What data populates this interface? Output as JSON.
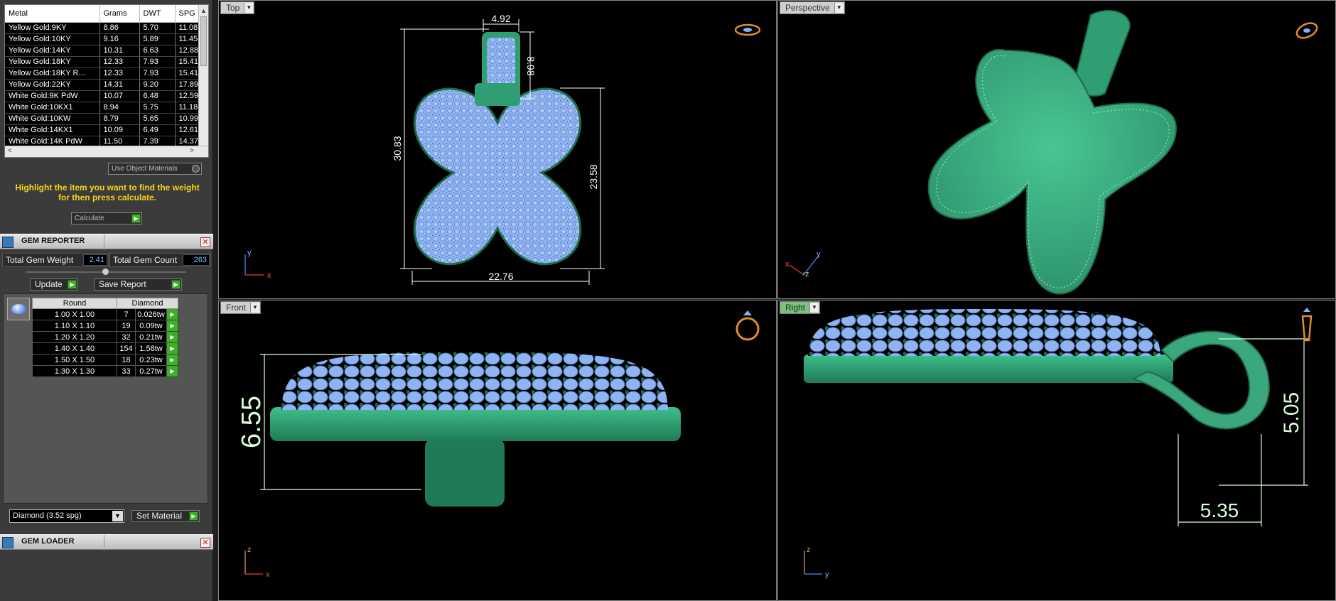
{
  "metal_table": {
    "headers": [
      "Metal",
      "Grams",
      "DWT",
      "SPG"
    ],
    "rows": [
      [
        "Yellow Gold:9KY",
        "8.86",
        "5.70",
        "11.08"
      ],
      [
        "Yellow Gold:10KY",
        "9.16",
        "5.89",
        "11.45"
      ],
      [
        "Yellow Gold:14KY",
        "10.31",
        "6.63",
        "12.88"
      ],
      [
        "Yellow Gold:18KY",
        "12.33",
        "7.93",
        "15.41"
      ],
      [
        "Yellow Gold:18KY R...",
        "12.33",
        "7.93",
        "15.41"
      ],
      [
        "Yellow Gold:22KY",
        "14.31",
        "9.20",
        "17.89"
      ],
      [
        "White Gold:9K PdW",
        "10.07",
        "6.48",
        "12.59"
      ],
      [
        "White Gold:10KX1",
        "8.94",
        "5.75",
        "11.18"
      ],
      [
        "White Gold:10KW",
        "8.79",
        "5.65",
        "10.99"
      ],
      [
        "White Gold:14KX1",
        "10.09",
        "6.49",
        "12.61"
      ],
      [
        "White Gold:14K PdW",
        "11.50",
        "7.39",
        "14.37"
      ]
    ]
  },
  "use_object_materials_label": "Use Object Materials",
  "hint_line1": "Highlight the item you want to find the weight",
  "hint_line2": "for then press calculate.",
  "calculate_label": "Calculate",
  "gem_reporter": {
    "title": "GEM REPORTER",
    "total_weight_label": "Total Gem Weight",
    "total_weight_value": "2.41",
    "total_count_label": "Total Gem Count",
    "total_count_value": "263",
    "update_label": "Update",
    "save_report_label": "Save Report",
    "table_headers": [
      "Round",
      "Diamond"
    ],
    "rows": [
      [
        "1.00 X 1.00",
        "7",
        "0.026tw"
      ],
      [
        "1.10 X 1.10",
        "19",
        "0.09tw"
      ],
      [
        "1.20 X 1.20",
        "32",
        "0.21tw"
      ],
      [
        "1.40 X 1.40",
        "154",
        "1.58tw"
      ],
      [
        "1.50 X 1.50",
        "18",
        "0.23tw"
      ],
      [
        "1.30 X 1.30",
        "33",
        "0.27tw"
      ]
    ]
  },
  "material_select_value": "Diamond    (3.52 spg)",
  "set_material_label": "Set Material",
  "gem_loader": {
    "title": "GEM LOADER"
  },
  "viewports": {
    "top": {
      "label": "Top",
      "dims": {
        "bail_width": "4.92",
        "bail_height": "8.98",
        "total_height": "30.83",
        "body_height": "23.58",
        "width": "22.76"
      },
      "axis": {
        "y": "y",
        "x": "x"
      }
    },
    "perspective": {
      "label": "Perspective",
      "axis": {
        "x": "x",
        "y": "y",
        "z": "z"
      }
    },
    "front": {
      "label": "Front",
      "dims": {
        "height": "6.55"
      },
      "axis": {
        "z": "z",
        "x": "x"
      }
    },
    "right": {
      "label": "Right",
      "dims": {
        "bail_height": "5.05",
        "bail_width": "5.35"
      },
      "axis": {
        "z": "z",
        "y": "y"
      }
    }
  },
  "colors": {
    "metal_green": "#2f9e73",
    "gem_blue": "#8fb4f2",
    "hint_yellow": "#f6d21b",
    "go_green": "#3fae2a",
    "active_tab_green": "#7fbf7f"
  }
}
